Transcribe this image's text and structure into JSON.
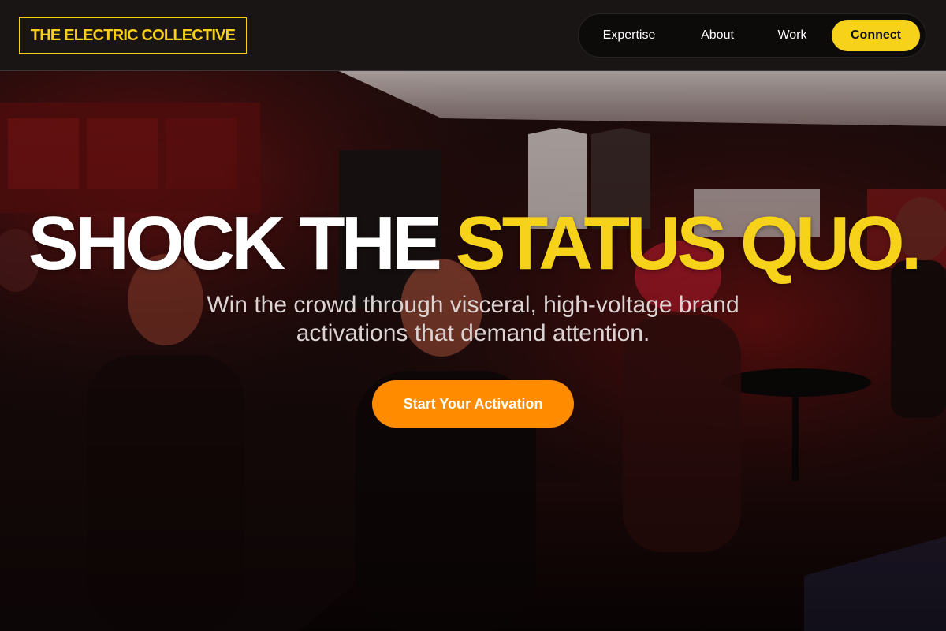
{
  "brand": {
    "logo_text": "THE ELECTRIC COLLECTIVE"
  },
  "nav": {
    "items": [
      {
        "label": "Expertise"
      },
      {
        "label": "About"
      },
      {
        "label": "Work"
      }
    ],
    "connect_label": "Connect"
  },
  "hero": {
    "headline_part1": "SHOCK THE ",
    "headline_accent": "STATUS QUO.",
    "subheadline": "Win the crowd through visceral, high-voltage brand activations that demand attention.",
    "cta_label": "Start Your Activation",
    "background_image": "crowd-at-event-photo"
  },
  "colors": {
    "accent_yellow": "#f7d21a",
    "cta_orange": "#ff8c00",
    "header_bg": "#1a1515",
    "hero_tint": "#8a1414"
  }
}
